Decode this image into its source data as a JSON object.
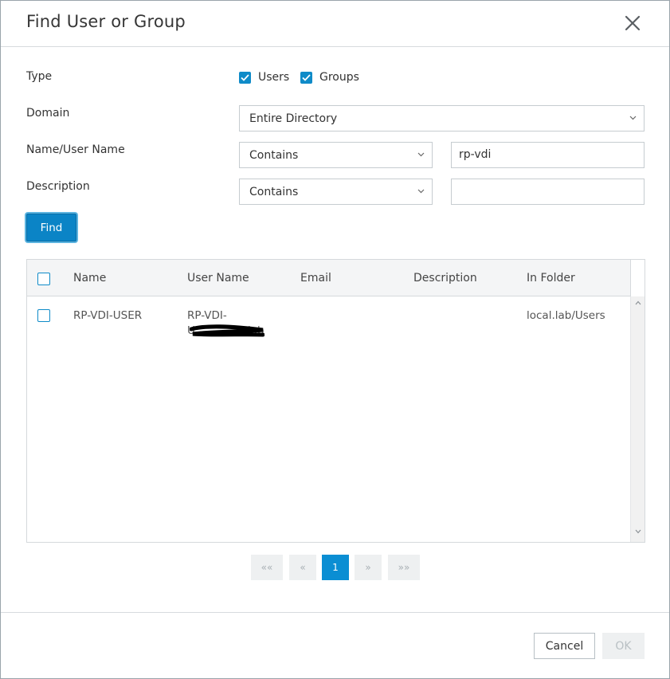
{
  "dialog": {
    "title": "Find User or Group"
  },
  "form": {
    "type_label": "Type",
    "type_options": [
      {
        "label": "Users",
        "checked": true
      },
      {
        "label": "Groups",
        "checked": true
      }
    ],
    "domain_label": "Domain",
    "domain_value": "Entire Directory",
    "name_label": "Name/User Name",
    "name_operator": "Contains",
    "name_value": "rp-vdi",
    "description_label": "Description",
    "description_operator": "Contains",
    "description_value": "",
    "find_label": "Find"
  },
  "results": {
    "columns": [
      "Name",
      "User Name",
      "Email",
      "Description",
      "In Folder"
    ],
    "rows": [
      {
        "name": "RP-VDI-USER",
        "user_name_line1": "RP-VDI-",
        "user_name_line2": "U",
        "user_name_tail": "lab",
        "email": "",
        "description": "",
        "in_folder": "local.lab/Users",
        "checked": false
      }
    ]
  },
  "pagination": {
    "first": "««",
    "prev": "«",
    "current": "1",
    "next": "»",
    "last": "»»"
  },
  "footer": {
    "cancel_label": "Cancel",
    "ok_label": "OK"
  },
  "colors": {
    "accent": "#0b84c6",
    "checkbox": "#0f8bc8",
    "border": "#c6ccd0",
    "disabled_text": "#b9c0c4"
  },
  "icons": {
    "close": "close-icon",
    "check": "check-icon",
    "dropdown": "chevron-down-icon",
    "scroll_up": "chevron-up-icon",
    "scroll_down": "chevron-down-icon"
  }
}
